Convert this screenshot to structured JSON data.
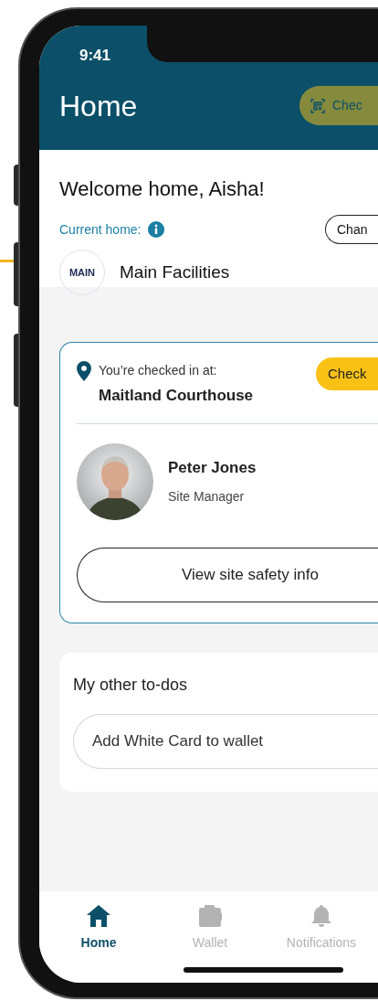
{
  "status_bar": {
    "time": "9:41"
  },
  "header": {
    "title": "Home",
    "check_in_button": "Chec"
  },
  "welcome": "Welcome home, Aisha!",
  "current_home": {
    "label": "Current home:",
    "change_button": "Chan",
    "logo_text": "MAIN",
    "name": "Main Facilities"
  },
  "checkin_card": {
    "label": "You’re checked in at:",
    "site": "Maitland Courthouse",
    "check_button": "Check",
    "contact": {
      "name": "Peter Jones",
      "role": "Site Manager"
    },
    "safety_button": "View site safety info"
  },
  "todos": {
    "title": "My other to-dos",
    "items": [
      "Add White Card to wallet"
    ]
  },
  "tab_bar": [
    {
      "kind": "home",
      "label": "Home",
      "selected": true
    },
    {
      "kind": "wallet",
      "label": "Wallet",
      "selected": false
    },
    {
      "kind": "bell",
      "label": "Notifications",
      "selected": false
    }
  ]
}
